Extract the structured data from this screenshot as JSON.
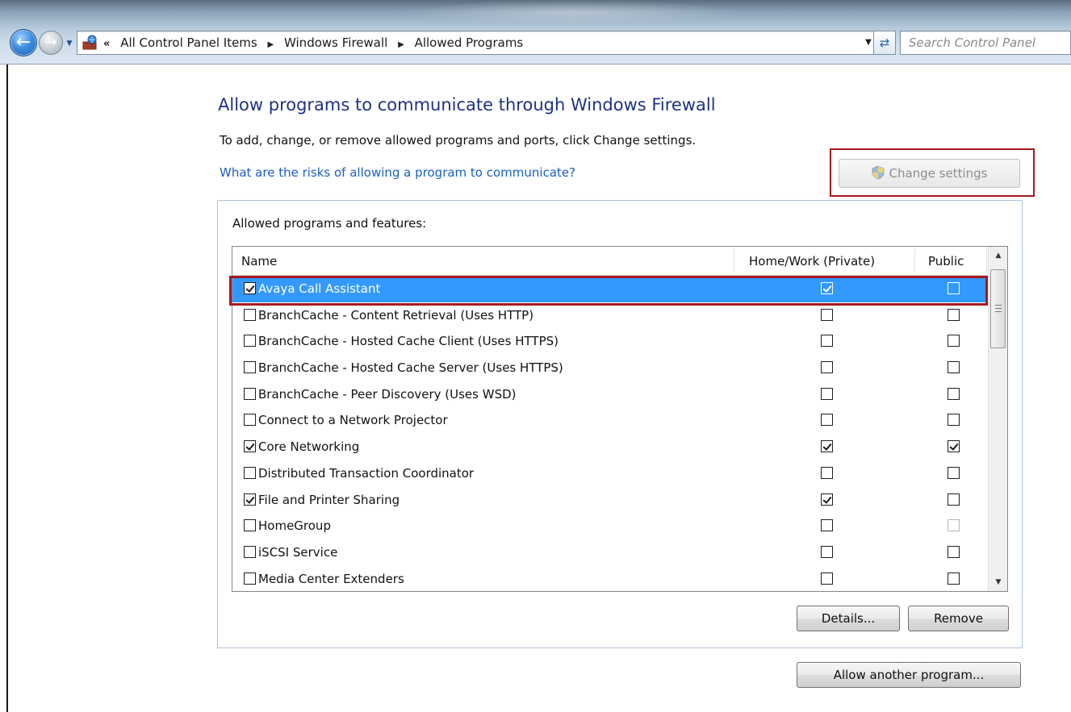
{
  "address_bar": {
    "breadcrumbs": [
      "All Control Panel Items",
      "Windows Firewall",
      "Allowed Programs"
    ],
    "search_placeholder": "Search Control Panel"
  },
  "content": {
    "title": "Allow programs to communicate through Windows Firewall",
    "description": "To add, change, or remove allowed programs and ports, click Change settings.",
    "risk_link": "What are the risks of allowing a program to communicate?",
    "change_settings_label": "Change settings"
  },
  "programs": {
    "group_label": "Allowed programs and features:",
    "columns": {
      "name": "Name",
      "private": "Home/Work (Private)",
      "public": "Public"
    },
    "rows": [
      {
        "name": "Avaya Call Assistant",
        "enabled": true,
        "private": true,
        "public": false,
        "selected": true
      },
      {
        "name": "BranchCache - Content Retrieval (Uses HTTP)",
        "enabled": false,
        "private": false,
        "public": false
      },
      {
        "name": "BranchCache - Hosted Cache Client (Uses HTTPS)",
        "enabled": false,
        "private": false,
        "public": false
      },
      {
        "name": "BranchCache - Hosted Cache Server (Uses HTTPS)",
        "enabled": false,
        "private": false,
        "public": false
      },
      {
        "name": "BranchCache - Peer Discovery (Uses WSD)",
        "enabled": false,
        "private": false,
        "public": false
      },
      {
        "name": "Connect to a Network Projector",
        "enabled": false,
        "private": false,
        "public": false
      },
      {
        "name": "Core Networking",
        "enabled": true,
        "private": true,
        "public": true
      },
      {
        "name": "Distributed Transaction Coordinator",
        "enabled": false,
        "private": false,
        "public": false
      },
      {
        "name": "File and Printer Sharing",
        "enabled": true,
        "private": true,
        "public": false
      },
      {
        "name": "HomeGroup",
        "enabled": false,
        "private": false,
        "public": false,
        "public_disabled": true
      },
      {
        "name": "iSCSI Service",
        "enabled": false,
        "private": false,
        "public": false
      },
      {
        "name": "Media Center Extenders",
        "enabled": false,
        "private": false,
        "public": false
      }
    ],
    "details_label": "Details...",
    "remove_label": "Remove",
    "allow_another_label": "Allow another program..."
  },
  "colors": {
    "accent_title": "#1e3287",
    "link": "#1a5ec9",
    "selection": "#3399ff",
    "highlight_box": "#a8181f"
  }
}
